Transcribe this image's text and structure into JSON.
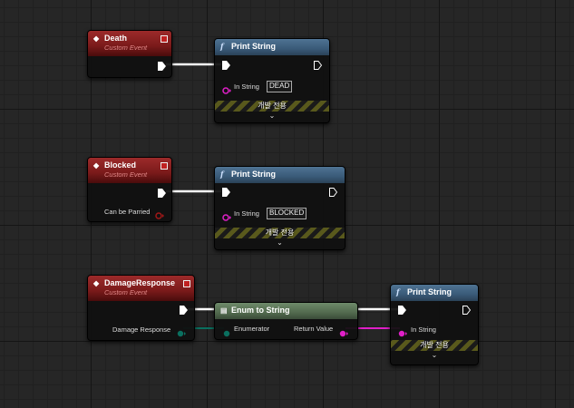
{
  "nodes": {
    "death_event": {
      "title": "Death",
      "subtitle": "Custom Event"
    },
    "print1": {
      "title": "Print String",
      "in_string_label": "In String",
      "in_string_value": "DEAD",
      "dev_only": "개발 전용"
    },
    "blocked_event": {
      "title": "Blocked",
      "subtitle": "Custom Event",
      "param_label": "Can be Parried"
    },
    "print2": {
      "title": "Print String",
      "in_string_label": "In String",
      "in_string_value": "BLOCKED",
      "dev_only": "개발 전용"
    },
    "damage_event": {
      "title": "DamageResponse",
      "subtitle": "Custom Event",
      "param_label": "Damage Response"
    },
    "enum_to_string": {
      "title": "Enum to String",
      "input_label": "Enumerator",
      "output_label": "Return Value"
    },
    "print3": {
      "title": "Print String",
      "in_string_label": "In String",
      "dev_only": "개발 전용"
    }
  },
  "colors": {
    "exec": "#ffffff",
    "string_pin": "#e020c8",
    "bool_pin": "#a01818",
    "enum_pin": "#0a6f5f",
    "event_header": "#8a2222",
    "function_header": "#456a8a",
    "conversion_header": "#5e7a5a"
  }
}
